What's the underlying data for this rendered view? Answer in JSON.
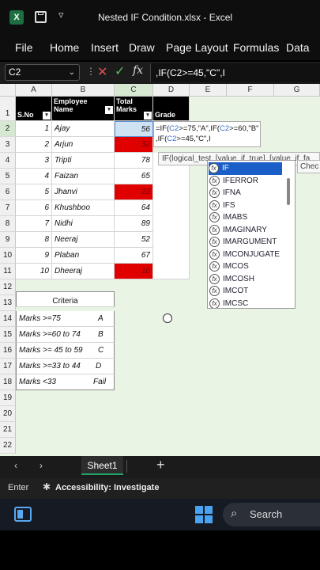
{
  "title": {
    "filename": "Nested IF Condition.xlsx",
    "app": "Excel",
    "separator": "-"
  },
  "menu": [
    "File",
    "Home",
    "Insert",
    "Draw",
    "Page Layout",
    "Formulas",
    "Data"
  ],
  "formula_bar": {
    "name_box": "C2",
    "fx": "fx",
    "formula": ",IF(C2>=45,\"C\",I"
  },
  "columns": [
    "A",
    "B",
    "C",
    "D",
    "E",
    "F",
    "G"
  ],
  "rows": [
    "1",
    "2",
    "3",
    "4",
    "5",
    "6",
    "7",
    "8",
    "9",
    "10",
    "11",
    "12",
    "13",
    "14",
    "15",
    "16",
    "17",
    "18",
    "19",
    "20",
    "21",
    "22"
  ],
  "table_headers": {
    "sno": "S.No",
    "name": "Employee Name",
    "marks": "Total Marks",
    "grade": "Grade"
  },
  "table_rows": [
    {
      "sno": "1",
      "name": "Ajay",
      "marks": "56"
    },
    {
      "sno": "2",
      "name": "Arjun",
      "marks": "32"
    },
    {
      "sno": "3",
      "name": "Tripti",
      "marks": "78"
    },
    {
      "sno": "4",
      "name": "Faizan",
      "marks": "65"
    },
    {
      "sno": "5",
      "name": "Jhanvi",
      "marks": "23"
    },
    {
      "sno": "6",
      "name": "Khushboo",
      "marks": "64"
    },
    {
      "sno": "7",
      "name": "Nidhi",
      "marks": "89"
    },
    {
      "sno": "8",
      "name": "Neeraj",
      "marks": "52"
    },
    {
      "sno": "9",
      "name": "Plaban",
      "marks": "67"
    },
    {
      "sno": "10",
      "name": "Dheeraj",
      "marks": "10"
    }
  ],
  "criteria": {
    "title": "Criteria",
    "rows": [
      {
        "label": "Marks >=75",
        "grade": "A"
      },
      {
        "label": "Marks >=60 to 74",
        "grade": "B"
      },
      {
        "label": "Marks >= 45 to 59",
        "grade": "C"
      },
      {
        "label": "Marks >=33 to 44",
        "grade": "D"
      },
      {
        "label": "Marks <33",
        "grade": "Fail"
      }
    ]
  },
  "editing": {
    "line1_prefix": "=IF(",
    "ref1": "C2",
    "line1_mid": ">=75,\"A\",IF(",
    "ref2": "C2",
    "line1_end": ">=60,\"B\"",
    "line2_prefix": ",IF(",
    "ref3": "C2",
    "line2_end": ">=45,\"C\",I"
  },
  "tooltip": {
    "text": "IF(logical_test, [value_if_true], [value_if_fa",
    "text2": "Chec"
  },
  "autocomplete": [
    "IF",
    "IFERROR",
    "IFNA",
    "IFS",
    "IMABS",
    "IMAGINARY",
    "IMARGUMENT",
    "IMCONJUGATE",
    "IMCOS",
    "IMCOSH",
    "IMCOT",
    "IMCSC"
  ],
  "sheet_tab": "Sheet1",
  "status": {
    "mode": "Enter",
    "accessibility": "Accessibility: Investigate"
  },
  "taskbar": {
    "search": "Search"
  },
  "colors": {
    "accent": "#21a366",
    "red_cell": "#e00000",
    "selection": "#cfe2f3",
    "sheet_bg": "#e9f4e4"
  }
}
